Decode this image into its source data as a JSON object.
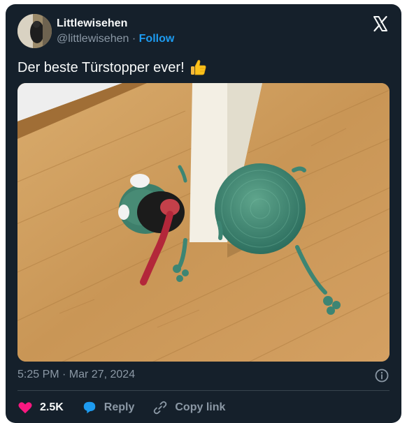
{
  "author": {
    "display_name": "Littlewisehen",
    "handle": "@littlewisehen",
    "separator": "·",
    "follow_label": "Follow"
  },
  "tweet": {
    "text": "Der beste Türstopper ever!"
  },
  "meta": {
    "timestamp": "5:25 PM · Mar 27, 2024"
  },
  "actions": {
    "like_count": "2.5K",
    "reply_label": "Reply",
    "copy_link_label": "Copy link"
  },
  "colors": {
    "background": "#15202b",
    "text": "#f7f9f9",
    "secondary": "#8b98a5",
    "accent": "#1d9bf0",
    "like": "#f91880"
  },
  "icons": {
    "logo": "x-logo-icon",
    "info": "info-icon",
    "like": "heart-icon",
    "reply": "speech-bubble-icon",
    "copy": "link-icon",
    "emoji": "thumbs-up-emoji"
  }
}
